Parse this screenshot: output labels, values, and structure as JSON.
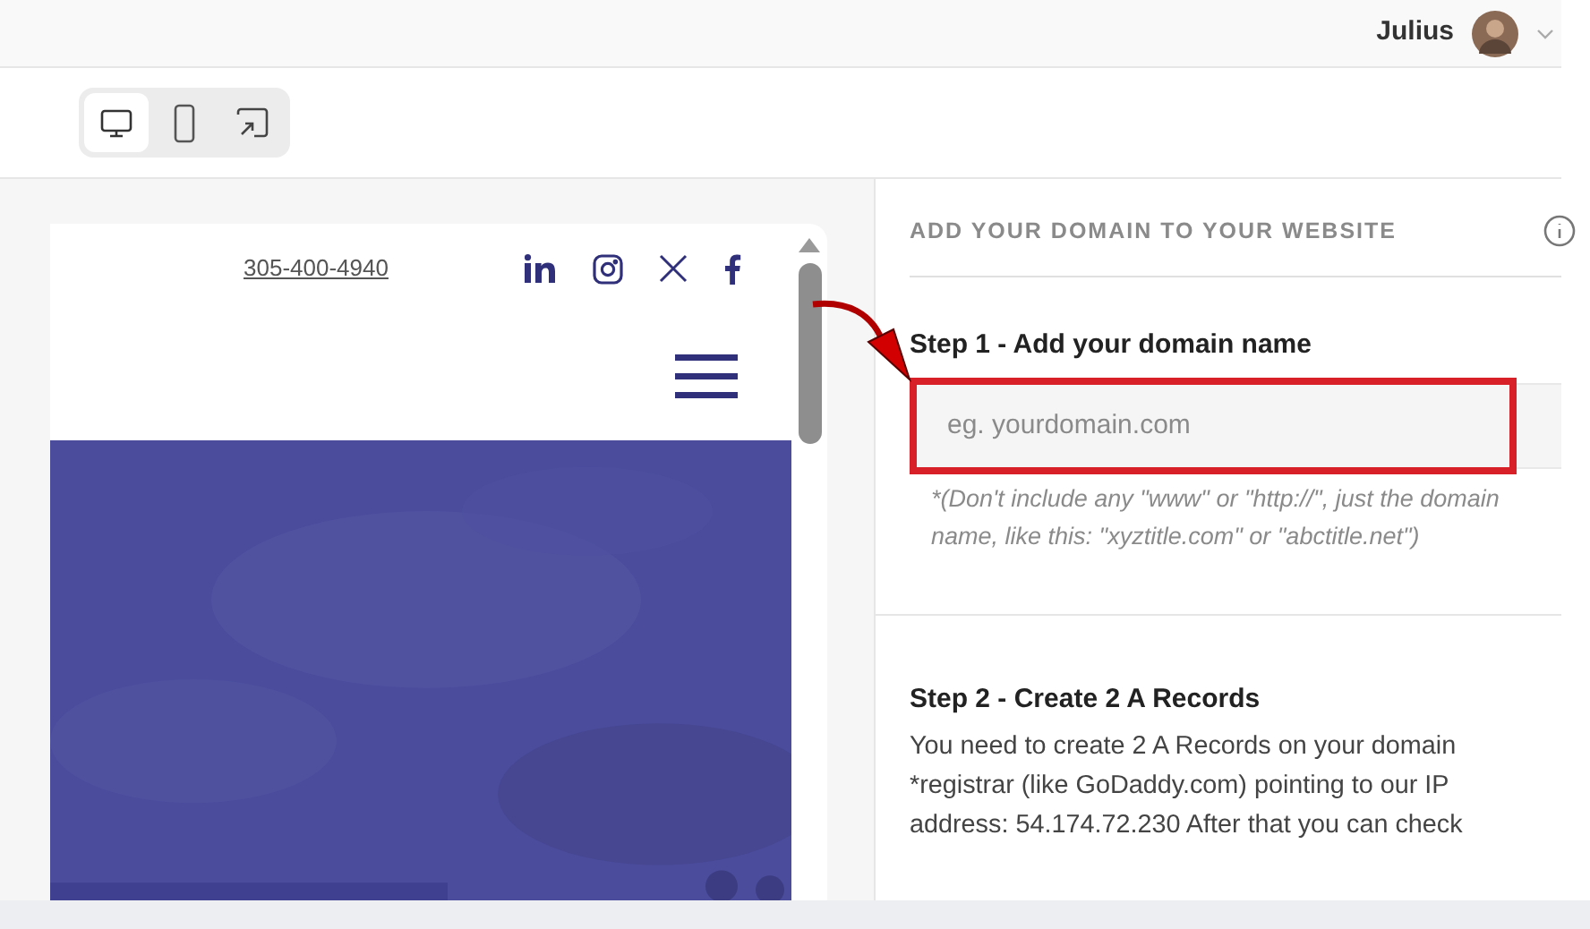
{
  "user": {
    "name": "Julius"
  },
  "view_modes": [
    {
      "kind": "desktop",
      "selected": true
    },
    {
      "kind": "mobile",
      "selected": false
    },
    {
      "kind": "fit",
      "selected": false
    }
  ],
  "preview": {
    "phone": "305-400-4940"
  },
  "domain_panel": {
    "heading": "ADD YOUR DOMAIN TO YOUR WEBSITE",
    "step1": {
      "title": "Step 1 - Add your domain name",
      "placeholder": "eg. yourdomain.com",
      "hint": "*(Don't include any \"www\" or \"http://\", just the domain name, like this: \"xyztitle.com\" or \"abctitle.net\")"
    },
    "step2": {
      "title": "Step 2 - Create 2 A Records",
      "text": "You need to create 2 A Records on your domain *registrar (like GoDaddy.com) pointing to our IP address: 54.174.72.230 After that you can check"
    }
  }
}
